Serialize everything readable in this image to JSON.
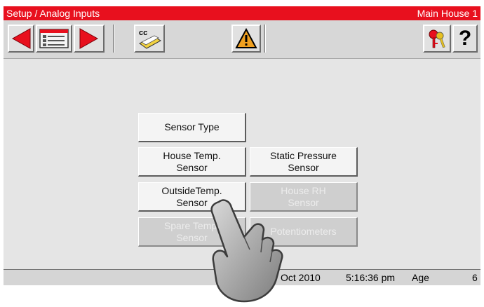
{
  "titlebar": {
    "title": "Setup / Analog Inputs",
    "house": "Main House 1"
  },
  "toolbar": {
    "buttons": [
      {
        "name": "back-arrow-icon",
        "color": "#e8101e"
      },
      {
        "name": "menu-list-icon"
      },
      {
        "name": "forward-arrow-icon",
        "color": "#e8101e"
      },
      {
        "name": "cc-copy-icon",
        "label": "cc"
      },
      {
        "name": "alarm-warning-icon",
        "label": "!",
        "color": "#f0a020"
      },
      {
        "name": "keys-icon"
      },
      {
        "name": "help-icon",
        "label": "?"
      }
    ]
  },
  "menu": {
    "sensor_type": "Sensor Type",
    "house_temp": "House Temp.\nSensor",
    "static_pressure": "Static Pressure\nSensor",
    "outside_temp": "OutsideTemp.\nSensor",
    "house_rh": "House RH\nSensor",
    "spare_temp": "Spare Temp.\nSensor",
    "potentiometers": "Potentiometers"
  },
  "statusbar": {
    "date": "Oct 2010",
    "time": "5:16:36 pm",
    "age_label": "Age",
    "age_value": "6"
  },
  "colors": {
    "title_red": "#e8101e",
    "disabled_text": "#ececec"
  }
}
